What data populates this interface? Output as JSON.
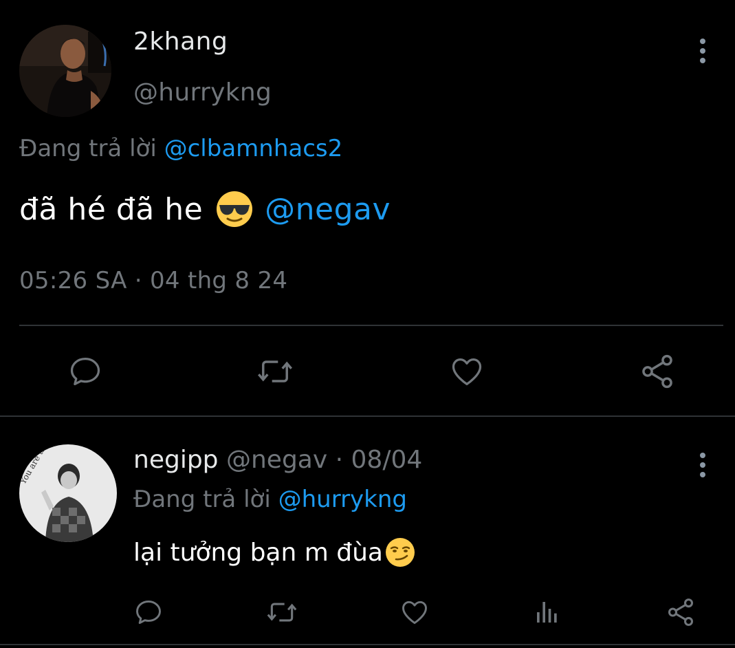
{
  "main_tweet": {
    "display_name": "2khang",
    "handle": "@hurrykng",
    "replying_prefix": "Đang trả lời",
    "replying_to": "@clbamnhacs2",
    "text": "đã hé đã he",
    "mention": "@negav",
    "timestamp": "05:26 SA · 04 thg 8 24"
  },
  "reply_tweet": {
    "display_name": "negipp",
    "handle": "@negav",
    "separator": " · ",
    "date": "08/04",
    "replying_prefix": "Đang trả lời",
    "replying_to": "@hurrykng",
    "text": "lại tưởng bạn m đùa"
  },
  "icons": {
    "reply": "reply-icon",
    "retweet": "retweet-icon",
    "like": "heart-icon",
    "views": "views-icon",
    "share": "share-icon",
    "more": "more-vertical-icon"
  },
  "colors": {
    "background": "#000000",
    "text_primary": "#ffffff",
    "text_secondary": "#71767b",
    "accent": "#1d9bf0",
    "divider": "#2f3336",
    "icon": "#71767b"
  }
}
